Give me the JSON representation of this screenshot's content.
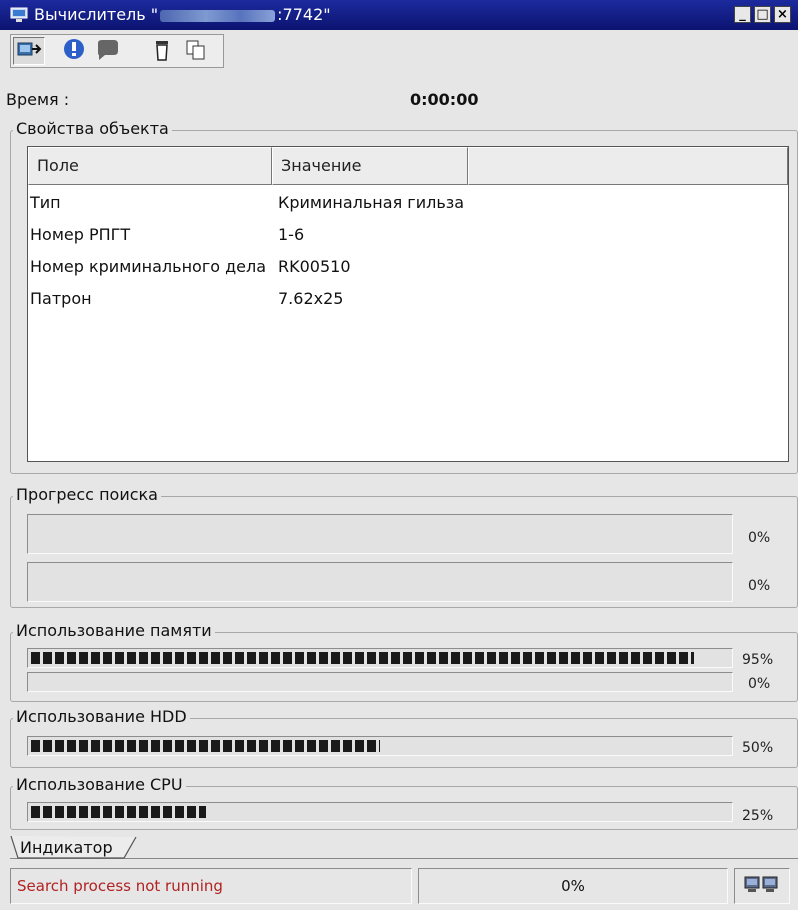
{
  "window": {
    "title_prefix": "Вычислитель \"",
    "title_suffix": ":7742\"",
    "minimize_glyph": "_",
    "maximize_glyph": "□",
    "close_glyph": "×"
  },
  "toolbar": {
    "buttons": [
      "connect-icon",
      "info-icon",
      "chat-icon",
      "delete-icon",
      "copy-icon"
    ]
  },
  "time": {
    "label": "Время :",
    "value": "0:00:00"
  },
  "object_props": {
    "legend": "Свойства объекта",
    "columns": [
      "Поле",
      "Значение",
      ""
    ],
    "rows": [
      {
        "field": "Тип",
        "value": "Криминальная гильза"
      },
      {
        "field": "Номер РПГТ",
        "value": "1-6"
      },
      {
        "field": "Номер криминального дела",
        "value": "RK00510"
      },
      {
        "field": "Патрон",
        "value": "7.62x25"
      }
    ]
  },
  "search_progress": {
    "legend": "Прогресс поиска",
    "bars": [
      {
        "percent": 0,
        "label": "0%"
      },
      {
        "percent": 0,
        "label": "0%"
      }
    ]
  },
  "memory": {
    "legend": "Использование памяти",
    "bars": [
      {
        "percent": 95,
        "label": "95%"
      },
      {
        "percent": 0,
        "label": "0%"
      }
    ]
  },
  "hdd": {
    "legend": "Использование HDD",
    "percent": 50,
    "label": "50%"
  },
  "cpu": {
    "legend": "Использование CPU",
    "percent": 25,
    "label": "25%"
  },
  "tabs": [
    {
      "label": "Индикатор"
    }
  ],
  "status": {
    "message": "Search process not running",
    "progress": "0%",
    "message_color": "#b22222"
  },
  "colors": {
    "titlebar": "#0c1470",
    "bar_fill": "#1a1a1a"
  }
}
